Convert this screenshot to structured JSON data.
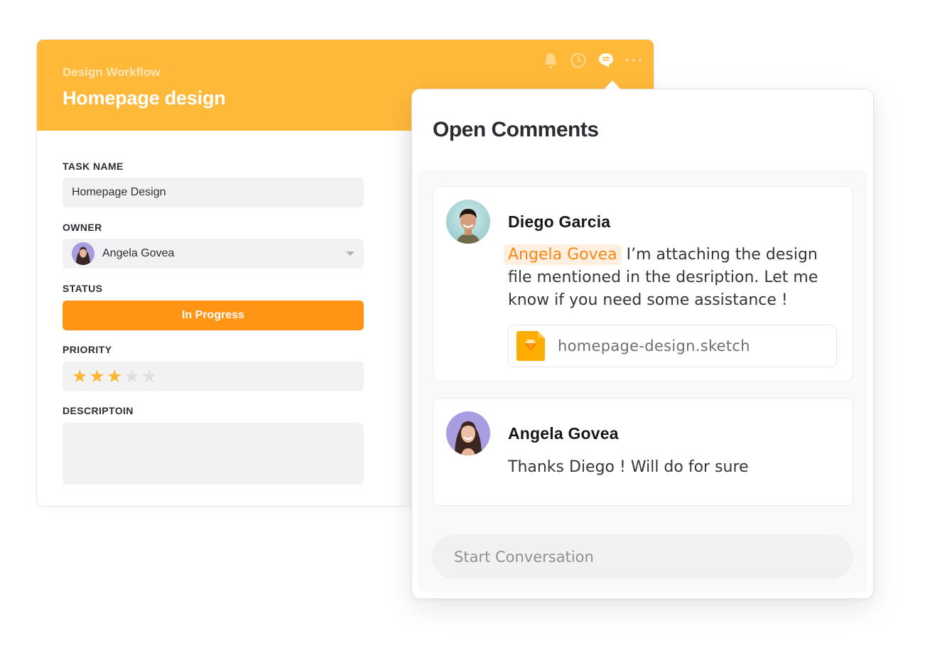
{
  "task": {
    "workflow": "Design Workflow",
    "title": "Homepage design",
    "header_icons": [
      "bell-icon",
      "clock-icon",
      "comment-icon",
      "more-icon"
    ],
    "active_header_icon": "comment-icon",
    "colors": {
      "header": "#ffb93a",
      "status": "#ff9314",
      "star_filled": "#ffb52e",
      "star_empty": "#dddee1"
    },
    "fields": {
      "task_name_label": "TASK NAME",
      "task_name_value": "Homepage Design",
      "owner_label": "OWNER",
      "owner_value": "Angela Govea",
      "status_label": "STATUS",
      "status_value": "In Progress",
      "priority_label": "PRIORITY",
      "priority_rating": 3,
      "priority_max": 5,
      "description_label": "DESCRIPTOIN",
      "description_value": ""
    }
  },
  "comments": {
    "title": "Open Comments",
    "items": [
      {
        "author": "Diego Garcia",
        "mention": "Angela Govea",
        "text": "I’m attaching the design file mentioned in the desription. Let me know if you need some assistance !",
        "attachment": {
          "name": "homepage-design.sketch",
          "icon": "sketch-file-icon"
        }
      },
      {
        "author": "Angela Govea",
        "text": "Thanks Diego ! Will do for sure"
      }
    ],
    "input_placeholder": "Start Conversation",
    "mention_color": "#ff8412"
  },
  "glyphs": {
    "star": "★"
  }
}
